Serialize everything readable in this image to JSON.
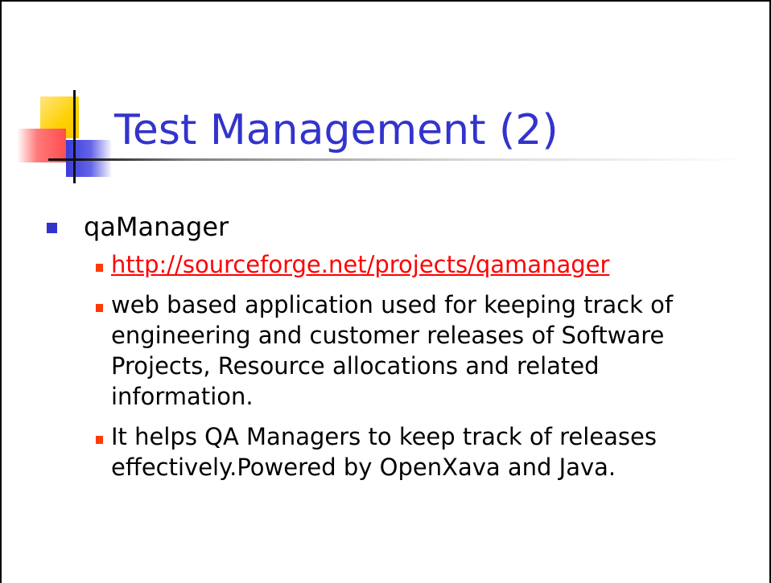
{
  "slide": {
    "title": "Test Management (2)",
    "bullets": [
      {
        "text": "qaManager",
        "sub_bullets": [
          {
            "text": "http://sourceforge.net/projects/qamanager",
            "is_link": true
          },
          {
            "text": "web based application used for keeping track of engineering and customer releases of Software Projects, Resource allocations and related information.",
            "is_link": false
          },
          {
            "text": "It helps QA Managers to keep track of releases effectively.Powered by OpenXava and Java.",
            "is_link": false
          }
        ]
      }
    ]
  },
  "colors": {
    "title": "#3333cc",
    "bullet_level1": "#3333cc",
    "bullet_level2": "#ff3b00",
    "link": "#ff0000"
  }
}
